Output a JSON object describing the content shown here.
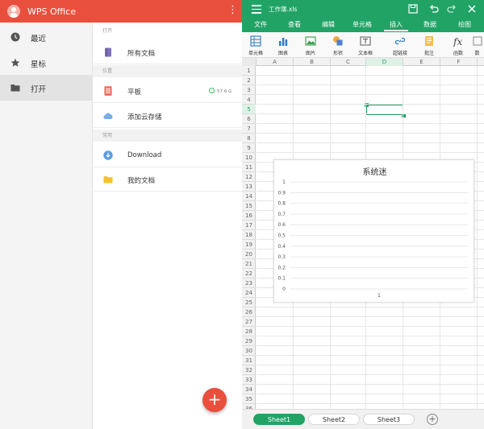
{
  "app": {
    "title": "WPS Office",
    "more_menu": "⋮"
  },
  "sidebar": {
    "items": [
      {
        "label": "最近",
        "icon": "clock-icon",
        "active": false
      },
      {
        "label": "星标",
        "icon": "star-icon",
        "active": false
      },
      {
        "label": "打开",
        "icon": "folder-icon",
        "active": true
      }
    ]
  },
  "content": {
    "sections": [
      {
        "header": "打开",
        "rows": [
          {
            "label": "所有文档",
            "icon": "book-icon"
          }
        ]
      },
      {
        "header": "位置",
        "rows": [
          {
            "label": "平板",
            "icon": "tablet-icon",
            "badge": "57.6 G"
          },
          {
            "label": "添加云存储",
            "icon": "cloud-icon"
          }
        ]
      },
      {
        "header": "常用",
        "rows": [
          {
            "label": "Download",
            "icon": "download-icon"
          },
          {
            "label": "我的文档",
            "icon": "folder-yellow-icon"
          }
        ]
      }
    ],
    "fab_label": "+"
  },
  "spreadsheet": {
    "file_name": "工作簿.xls",
    "menu_tabs": [
      {
        "label": "文件",
        "active": false
      },
      {
        "label": "查看",
        "active": false
      },
      {
        "label": "编辑",
        "active": false
      },
      {
        "label": "单元格",
        "active": false
      },
      {
        "label": "插入",
        "active": true
      },
      {
        "label": "数据",
        "active": false
      },
      {
        "label": "绘图",
        "active": false
      }
    ],
    "ribbon": [
      {
        "label": "单元格",
        "icon": "insert-cell-icon"
      },
      {
        "label": "图表",
        "icon": "chart-icon"
      },
      {
        "label": "图片",
        "icon": "picture-icon"
      },
      {
        "label": "形状",
        "icon": "shape-icon"
      },
      {
        "label": "文本框",
        "icon": "textbox-icon"
      },
      {
        "label": "超链接",
        "icon": "link-icon"
      },
      {
        "label": "批注",
        "icon": "comment-icon"
      },
      {
        "label": "函数",
        "icon": "function-icon"
      },
      {
        "label": "数",
        "icon": "number-icon"
      }
    ],
    "columns": [
      "A",
      "B",
      "C",
      "D",
      "E",
      "F"
    ],
    "selected_column": "D",
    "selected_row": 5,
    "row_count": 36,
    "sheets": [
      {
        "label": "Sheet1",
        "active": true
      },
      {
        "label": "Sheet2",
        "active": false
      },
      {
        "label": "Sheet3",
        "active": false
      }
    ],
    "add_sheet": "+"
  },
  "colors": {
    "wps_red": "#e94f3d",
    "sheet_green": "#21a366"
  },
  "chart_data": {
    "type": "bar",
    "title": "系统迷",
    "categories": [
      "1"
    ],
    "values": [
      0
    ],
    "yticks": [
      "0",
      "0.1",
      "0.2",
      "0.3",
      "0.4",
      "0.5",
      "0.6",
      "0.7",
      "0.8",
      "0.9",
      "1"
    ],
    "ylim": [
      0,
      1
    ],
    "grid": true,
    "xlabel": "",
    "ylabel": ""
  }
}
